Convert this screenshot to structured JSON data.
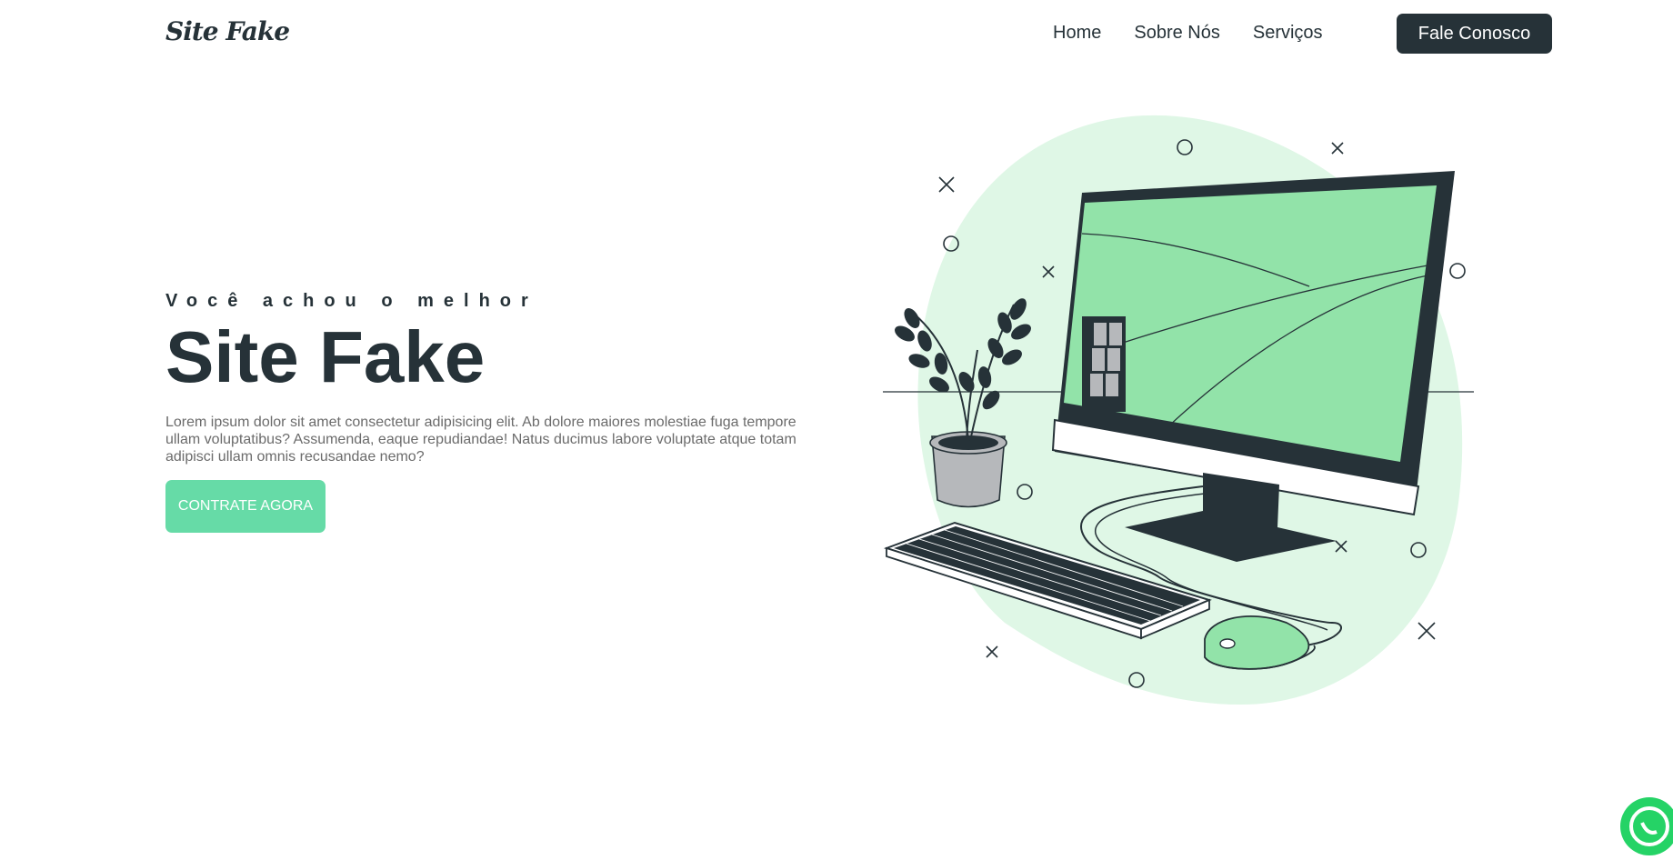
{
  "header": {
    "logo": "Site Fake",
    "nav": [
      {
        "label": "Home"
      },
      {
        "label": "Sobre Nós"
      },
      {
        "label": "Serviços"
      }
    ],
    "cta_label": "Fale Conosco"
  },
  "hero": {
    "eyebrow": "Você achou o melhor",
    "title": "Site Fake",
    "description": "Lorem ipsum dolor sit amet consectetur adipisicing elit. Ab dolore maiores molestiae fuga tempore ullam voluptatibus? Assumenda, eaque repudiandae! Natus ducimus labore voluptate atque totam adipisci ullam omnis recusandae nemo?",
    "button_label": "CONTRATE AGORA",
    "illustration_icon": "computer-desk-illustration"
  },
  "floating": {
    "icon": "whatsapp-icon"
  },
  "colors": {
    "dark": "#263238",
    "accent": "#66dba7",
    "screen_green": "#92e3a9",
    "blob": "#dff7e6",
    "whatsapp": "#25d366"
  }
}
